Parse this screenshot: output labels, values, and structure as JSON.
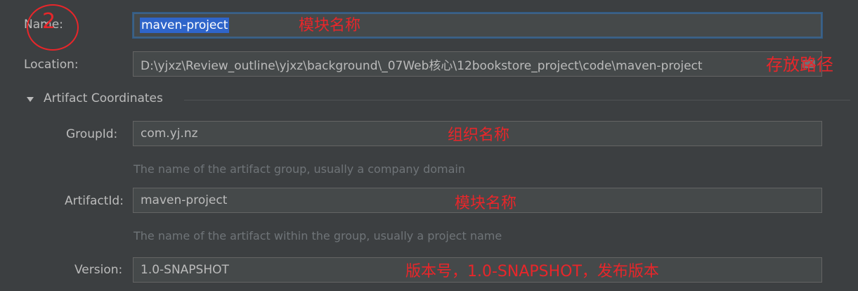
{
  "name": {
    "label": "Name:",
    "value": "maven-project"
  },
  "location": {
    "label": "Location:",
    "value": "D:\\yjxz\\Review_outline\\yjxz\\background\\_07Web核心\\12bookstore_project\\code\\maven-project"
  },
  "artifact": {
    "section_title": "Artifact Coordinates",
    "group_id": {
      "label": "GroupId:",
      "value": "com.yj.nz",
      "hint": "The name of the artifact group, usually a company domain"
    },
    "artifact_id": {
      "label": "ArtifactId:",
      "value": "maven-project",
      "hint": "The name of the artifact within the group, usually a project name"
    },
    "version": {
      "label": "Version:",
      "value": "1.0-SNAPSHOT"
    }
  },
  "annotations": {
    "circle_number": "2",
    "module_name_1": "模块名称",
    "storage_path": "存放路径",
    "org_name": "组织名称",
    "module_name_2": "模块名称",
    "version_note": "版本号，1.0-SNAPSHOT，发布版本"
  }
}
